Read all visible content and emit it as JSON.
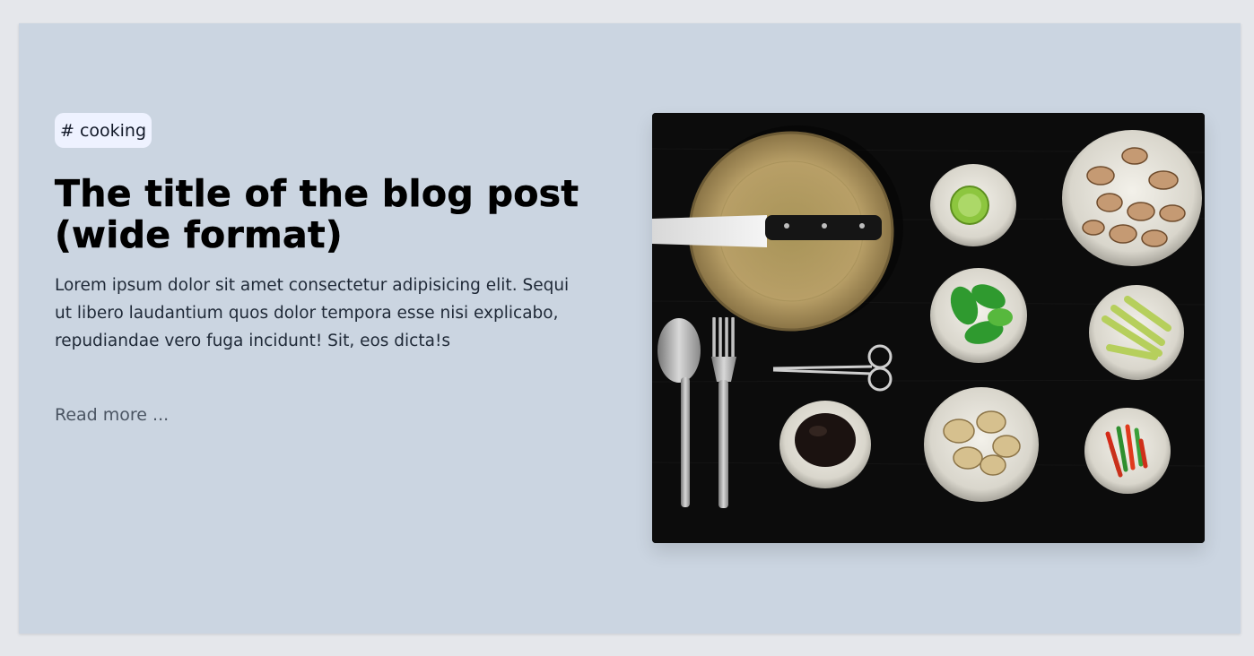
{
  "post": {
    "tag": "# cooking",
    "title_line1": "The title of the blog post",
    "title_line2": "(wide format)",
    "excerpt": "Lorem ipsum dolor sit amet consectetur adipisicing elit. Sequi ut libero laudantium quos dolor tempora esse nisi explicabo, repudiandae vero fuga incidunt! Sit, eos dicta!s",
    "read_more": "Read more ..."
  },
  "image": {
    "subject": "cooking ingredients flat lay with cutting board, knife, cutlery, scissors and bowls"
  },
  "colors": {
    "page_background": "#e5e7eb",
    "card_background": "#cbd5e1",
    "tag_background": "#eef2ff",
    "title_color": "#000000",
    "read_more_color": "#4b5563"
  }
}
